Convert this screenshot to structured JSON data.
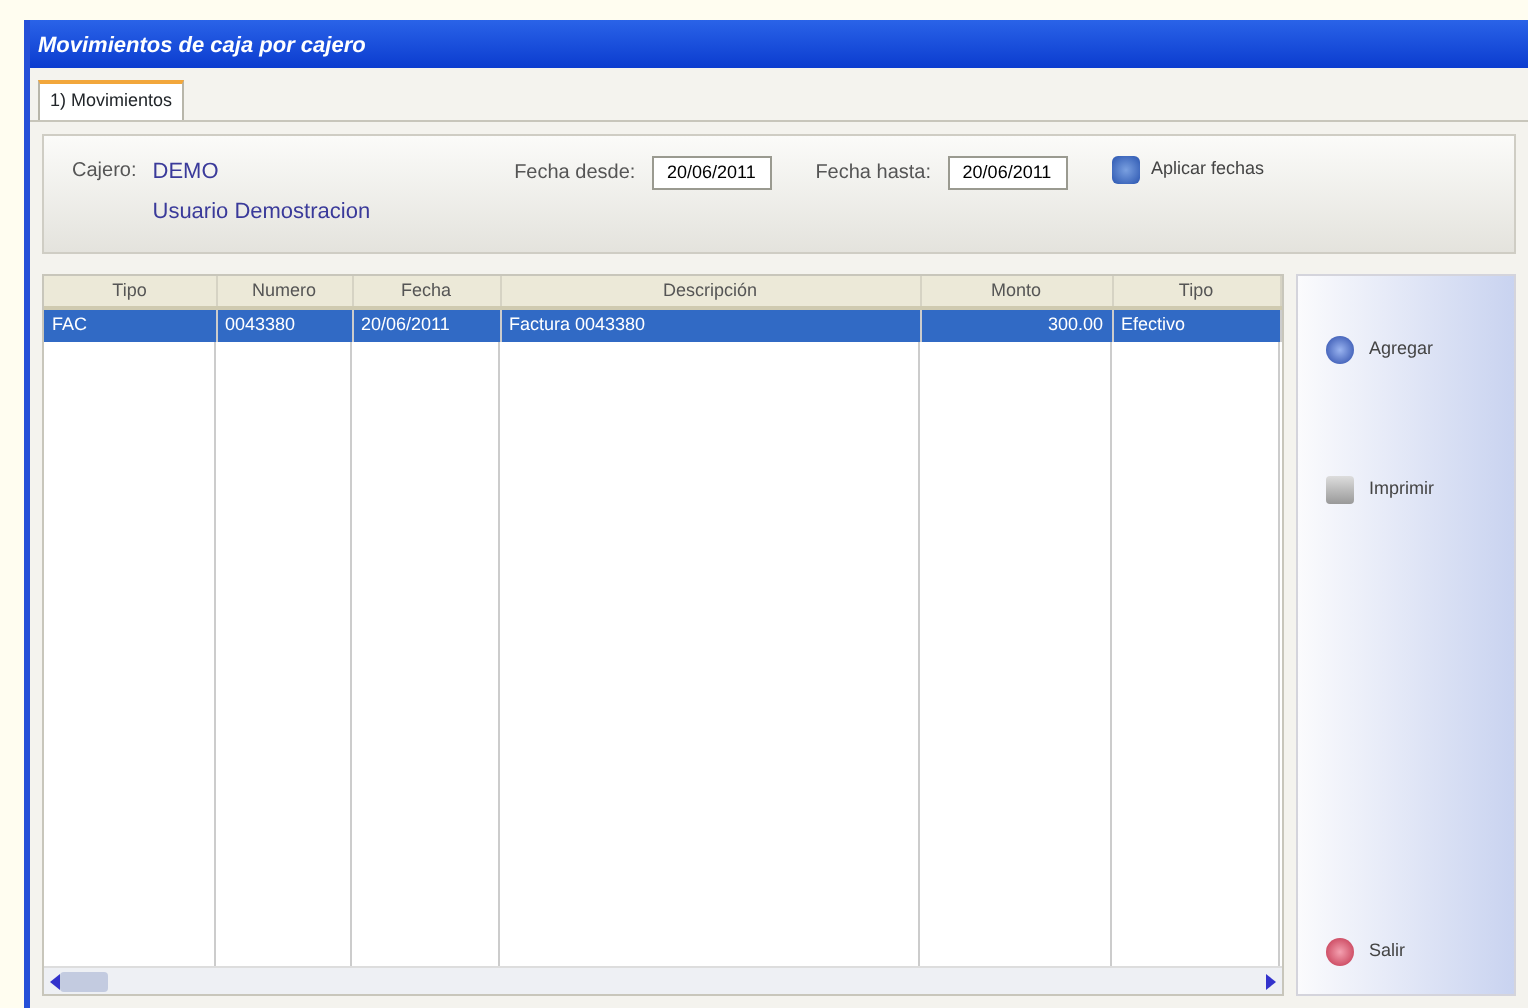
{
  "window": {
    "title": "Movimientos de caja por cajero"
  },
  "tabs": [
    {
      "label": "1) Movimientos",
      "selected": true
    }
  ],
  "filter": {
    "cajero_label": "Cajero:",
    "cajero_code": "DEMO",
    "cajero_name": "Usuario Demostracion",
    "from_label": "Fecha desde:",
    "from_value": "20/06/2011",
    "to_label": "Fecha hasta:",
    "to_value": "20/06/2011",
    "apply_button": "Aplicar fechas"
  },
  "table": {
    "columns": [
      "Tipo",
      "Numero",
      "Fecha",
      "Descripción",
      "Monto",
      "Tipo"
    ],
    "rows": [
      {
        "cells": [
          "FAC",
          "0043380",
          "20/06/2011",
          "Factura 0043380",
          "300.00",
          "Efectivo"
        ],
        "selected": true
      }
    ]
  },
  "side_buttons": [
    {
      "label": "Agregar",
      "kind": "add"
    },
    {
      "label": "Imprimir",
      "kind": "print"
    },
    {
      "label": "Salir",
      "kind": "exit"
    }
  ]
}
